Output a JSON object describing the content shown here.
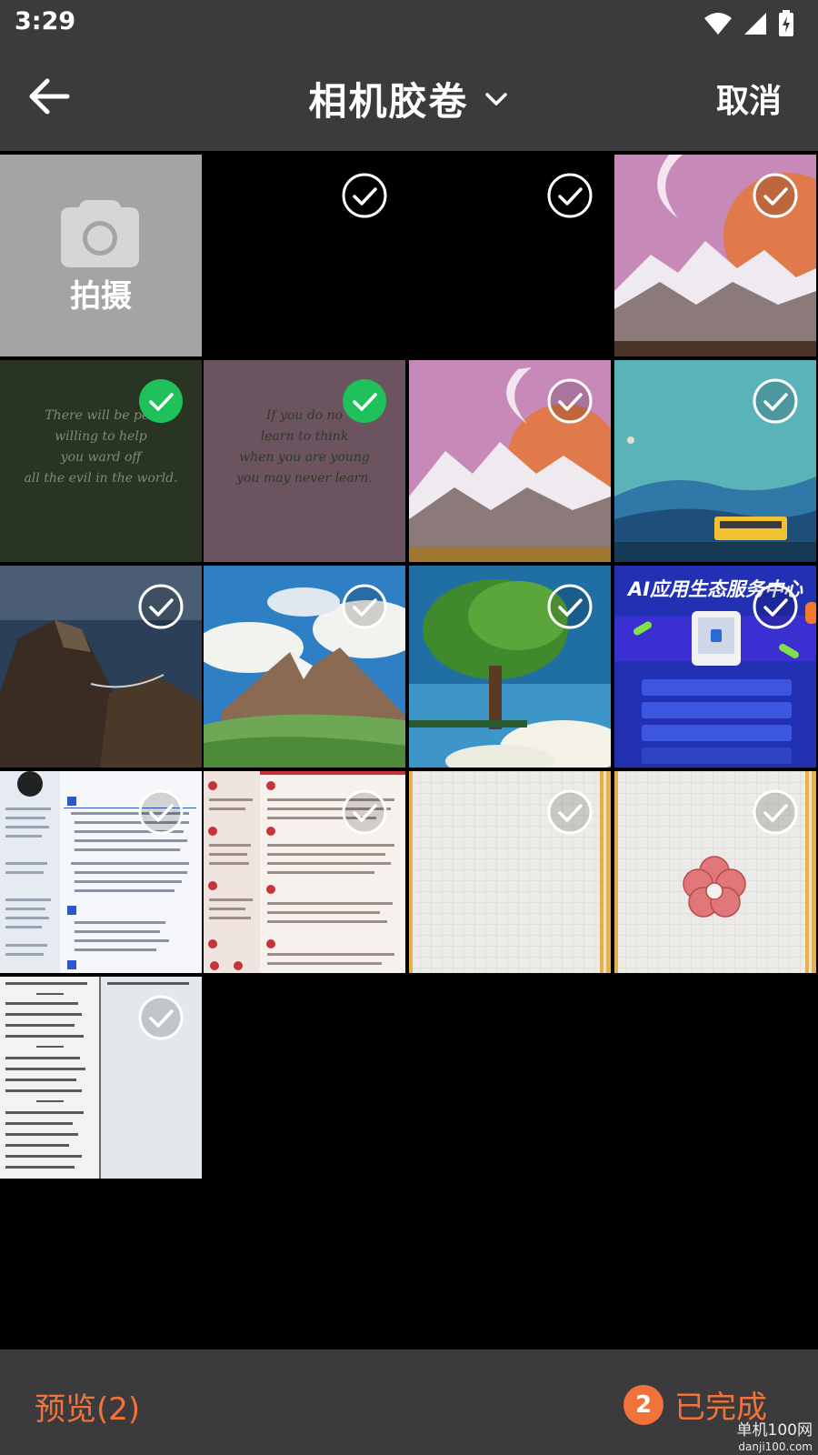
{
  "status_bar": {
    "time": "3:29",
    "icons": [
      "wifi-icon",
      "cellular-signal-icon",
      "battery-charging-icon"
    ]
  },
  "header": {
    "back_icon": "arrow-left-icon",
    "title": "相机胶卷",
    "dropdown_icon": "chevron-down-icon",
    "cancel_label": "取消"
  },
  "grid": {
    "camera_tile": {
      "icon": "camera-icon",
      "label": "拍摄"
    },
    "photos": [
      {
        "name": "photo-black-1",
        "selected": false
      },
      {
        "name": "photo-black-2",
        "selected": false
      },
      {
        "name": "photo-moon-mountains-1",
        "selected": false
      },
      {
        "name": "photo-quote-green",
        "selected": true,
        "lines": [
          "There will be peo",
          "willing to help",
          "you ward off",
          "all the evil in the world."
        ]
      },
      {
        "name": "photo-quote-mauve",
        "selected": true,
        "lines": [
          "If you do no",
          "learn to think",
          "when you are young",
          "you may never learn."
        ]
      },
      {
        "name": "photo-moon-mountains-2",
        "selected": false
      },
      {
        "name": "photo-blue-hills-bus",
        "selected": false
      },
      {
        "name": "photo-sea-cliffs",
        "selected": false
      },
      {
        "name": "photo-snow-peak-clouds",
        "selected": false
      },
      {
        "name": "photo-green-tree",
        "selected": false
      },
      {
        "name": "photo-ai-service-poster",
        "selected": false,
        "title": "AI应用生态服务中心"
      },
      {
        "name": "photo-resume-blue",
        "selected": false
      },
      {
        "name": "photo-resume-red",
        "selected": false
      },
      {
        "name": "photo-grid-paper-plain",
        "selected": false
      },
      {
        "name": "photo-grid-paper-flower",
        "selected": false
      },
      {
        "name": "photo-vocabulary-notes",
        "selected": false
      }
    ]
  },
  "bottom_bar": {
    "preview_label": "预览(2)",
    "done_count": "2",
    "done_label": "已完成"
  },
  "watermark": {
    "text": "单机100网",
    "sub": "danji100.com"
  },
  "colors": {
    "accent": "#f2733a",
    "selected_check": "#1fc25a",
    "bar_background": "#3b3b3d"
  }
}
